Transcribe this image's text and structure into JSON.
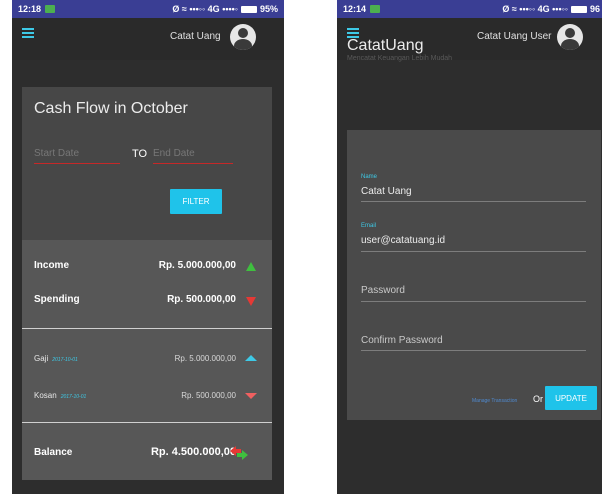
{
  "left_screen": {
    "status": {
      "time": "12:18",
      "signal_text": "Ø ≈ •••◦◦ 4G ••••◦",
      "battery": "95%"
    },
    "appbar": {
      "user_name": "Catat Uang"
    },
    "filter_card": {
      "title": "Cash Flow in October",
      "start_date_placeholder": "Start Date",
      "to_label": "TO",
      "end_date_placeholder": "End Date",
      "filter_label": "FILTER"
    },
    "summary": {
      "income_label": "Income",
      "income_value": "Rp. 5.000.000,00",
      "spending_label": "Spending",
      "spending_value": "Rp. 500.000,00",
      "transactions": [
        {
          "name": "Gaji",
          "date": "2017-10-01",
          "amount": "Rp. 5.000.000,00",
          "direction": "up"
        },
        {
          "name": "Kosan",
          "date": "2017-10-01",
          "amount": "Rp. 500.000,00",
          "direction": "down"
        }
      ],
      "balance_label": "Balance",
      "balance_value": "Rp. 4.500.000,00"
    }
  },
  "right_screen": {
    "status": {
      "time": "12:14",
      "signal_text": "Ø ≈ •••◦◦ 4G •••◦◦",
      "battery": "96"
    },
    "appbar": {
      "user_name": "Catat Uang User"
    },
    "brand": {
      "title": "CatatUang",
      "subtitle": "Mencatat Keuangan Lebih Mudah"
    },
    "form": {
      "name_label": "Name",
      "name_value": "Catat Uang",
      "email_label": "Email",
      "email_value": "user@catatuang.id",
      "password_placeholder": "Password",
      "confirm_placeholder": "Confirm Password",
      "manage_link": "Manage Transaction",
      "or_label": "Or",
      "update_label": "UPDATE"
    }
  },
  "colors": {
    "accent": "#1fc3ea",
    "statusbar": "#3a3e94",
    "income": "#3fbf3f",
    "spending": "#e53935"
  }
}
